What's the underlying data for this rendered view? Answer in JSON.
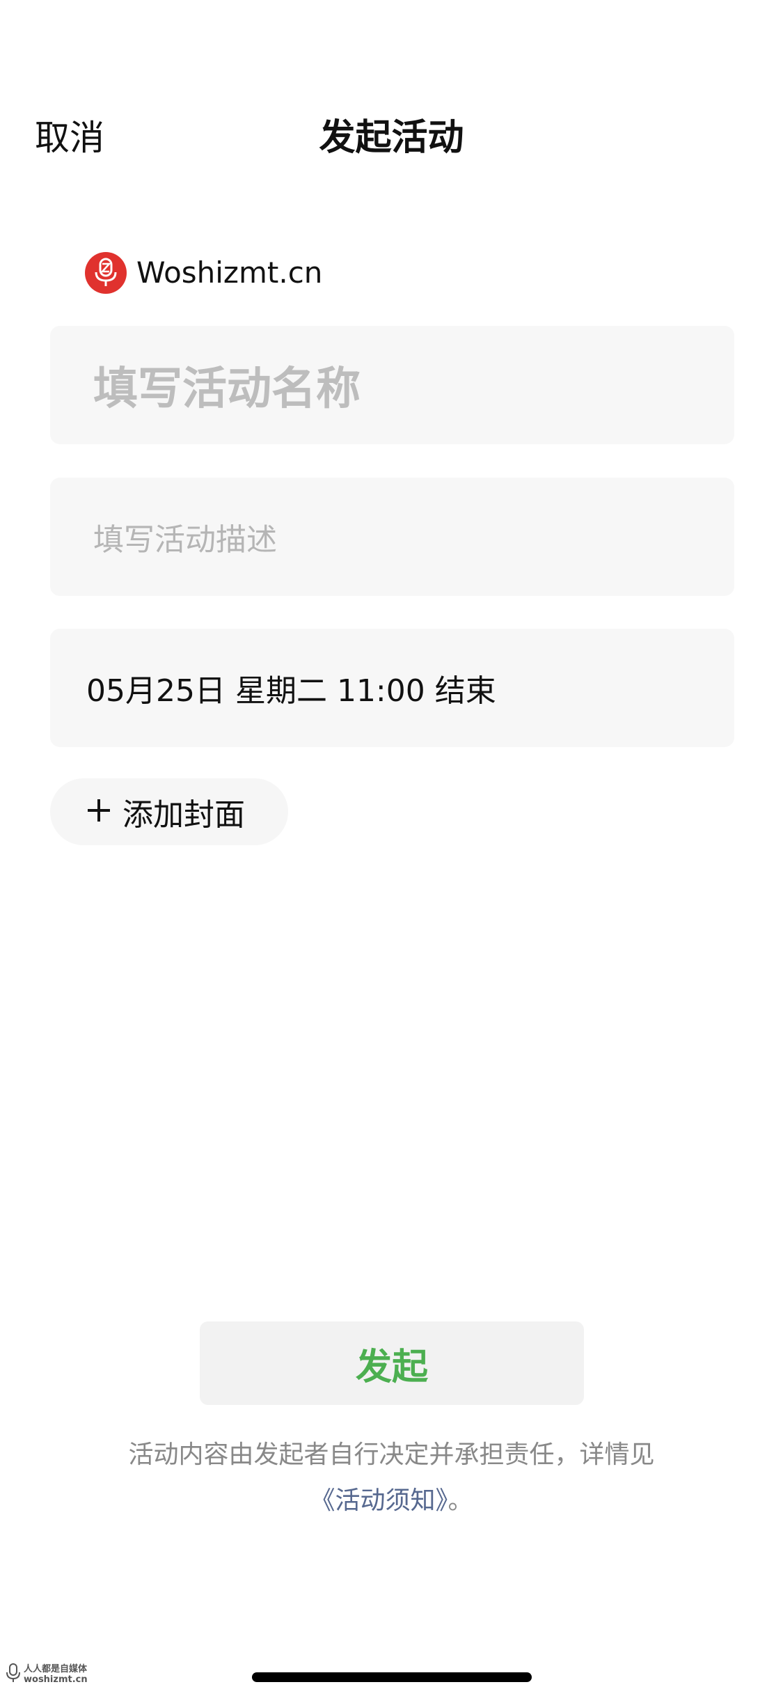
{
  "header": {
    "cancel_label": "取消",
    "title": "发起活动"
  },
  "account": {
    "name": "Woshizmt.cn",
    "avatar_icon": "microphone-icon",
    "avatar_color": "#e0322e"
  },
  "form": {
    "name_placeholder": "填写活动名称",
    "description_placeholder": "填写活动描述",
    "end_time": "05月25日 星期二 11:00 结束",
    "add_cover_label": "添加封面",
    "add_cover_icon": "plus-icon"
  },
  "actions": {
    "submit_label": "发起",
    "submit_color": "#4caf50"
  },
  "notice": {
    "text": "活动内容由发起者自行决定并承担责任，详情见",
    "link": "《活动须知》",
    "end": "。",
    "link_color": "#56688f"
  },
  "watermark": {
    "line1": "人人都是自媒体",
    "line2": "woshizmt.cn"
  }
}
